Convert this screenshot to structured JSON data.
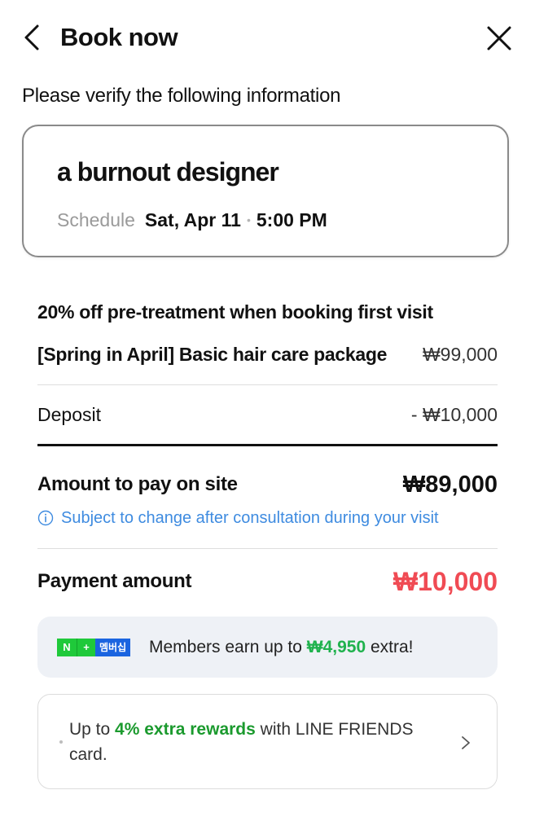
{
  "header": {
    "title": "Book now",
    "back_icon": "chevron-left-icon",
    "close_icon": "close-icon"
  },
  "verify_text": "Please verify the following information",
  "shop": {
    "name": "a burnout designer",
    "schedule_label": "Schedule",
    "date": "Sat, Apr 11",
    "separator": "•",
    "time": "5:00 PM"
  },
  "promo": {
    "title": "20% off pre-treatment when booking first visit"
  },
  "package": {
    "name": "[Spring in April] Basic hair care package",
    "price": "₩99,000"
  },
  "deposit": {
    "label": "Deposit",
    "value": "- ₩10,000"
  },
  "onsite": {
    "label": "Amount to pay on site",
    "value": "₩89,000",
    "notice": "Subject to change after consultation during your visit"
  },
  "payment": {
    "label": "Payment amount",
    "value": "₩10,000"
  },
  "membership": {
    "badge_n": "N",
    "badge_plus": "+",
    "badge_word": "멤버십",
    "text_before": "Members earn up to ",
    "amount": "₩4,950",
    "text_after": " extra!"
  },
  "card_offer": {
    "text_before": "Up to ",
    "highlight": "4% extra rewards",
    "text_after": " with LINE FRIENDS card."
  },
  "colors": {
    "accent_red": "#f04b54",
    "notice_blue": "#3e8be0",
    "member_green": "#1fb24d",
    "card_green": "#1b9a2e"
  }
}
